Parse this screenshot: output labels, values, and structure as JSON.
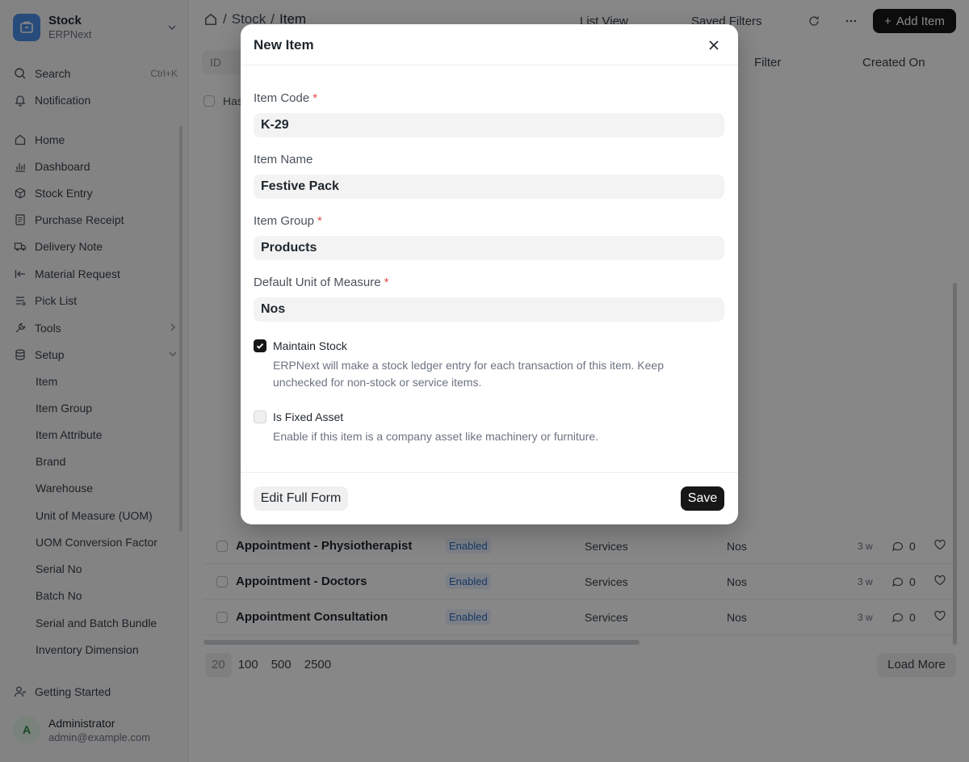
{
  "app": {
    "name": "Stock",
    "subtitle": "ERPNext"
  },
  "sidebar": {
    "search": "Search",
    "search_shortcut": "Ctrl+K",
    "notification": "Notification",
    "nav": [
      {
        "label": "Home"
      },
      {
        "label": "Dashboard"
      },
      {
        "label": "Stock Entry"
      },
      {
        "label": "Purchase Receipt"
      },
      {
        "label": "Delivery Note"
      },
      {
        "label": "Material Request"
      },
      {
        "label": "Pick List"
      },
      {
        "label": "Tools"
      },
      {
        "label": "Setup"
      }
    ],
    "setup_items": [
      "Item",
      "Item Group",
      "Item Attribute",
      "Brand",
      "Warehouse",
      "Unit of Measure (UOM)",
      "UOM Conversion Factor",
      "Serial No",
      "Batch No",
      "Serial and Batch Bundle",
      "Inventory Dimension"
    ],
    "getting_started": "Getting Started",
    "user": {
      "initial": "A",
      "name": "Administrator",
      "email": "admin@example.com"
    }
  },
  "topbar": {
    "breadcrumb": [
      "Stock",
      "Item"
    ],
    "list_view": "List View",
    "saved_filters": "Saved Filters",
    "add_item": "Add Item"
  },
  "filters": {
    "id_placeholder": "ID",
    "filter": "Filter",
    "sort": "Created On",
    "has_variants": "Has"
  },
  "list": {
    "rows": [
      {
        "name": "Appointment - Physiotherapist",
        "status": "Enabled",
        "group": "Services",
        "uom": "Nos",
        "age": "3 w",
        "comments": "0"
      },
      {
        "name": "Appointment - Doctors",
        "status": "Enabled",
        "group": "Services",
        "uom": "Nos",
        "age": "3 w",
        "comments": "0"
      },
      {
        "name": "Appointment Consultation",
        "status": "Enabled",
        "group": "Services",
        "uom": "Nos",
        "age": "3 w",
        "comments": "0"
      }
    ],
    "page_sizes": [
      "20",
      "100",
      "500",
      "2500"
    ],
    "load_more": "Load More"
  },
  "modal": {
    "title": "New Item",
    "fields": {
      "item_code": {
        "label": "Item Code",
        "value": "K-29"
      },
      "item_name": {
        "label": "Item Name",
        "value": "Festive Pack"
      },
      "item_group": {
        "label": "Item Group",
        "value": "Products"
      },
      "uom": {
        "label": "Default Unit of Measure",
        "value": "Nos"
      }
    },
    "maintain_stock": {
      "label": "Maintain Stock",
      "description": "ERPNext will make a stock ledger entry for each transaction of this item. Keep unchecked for non-stock or service items."
    },
    "fixed_asset": {
      "label": "Is Fixed Asset",
      "description": "Enable if this item is a company asset like machinery or furniture."
    },
    "edit_full_form": "Edit Full Form",
    "save": "Save"
  }
}
